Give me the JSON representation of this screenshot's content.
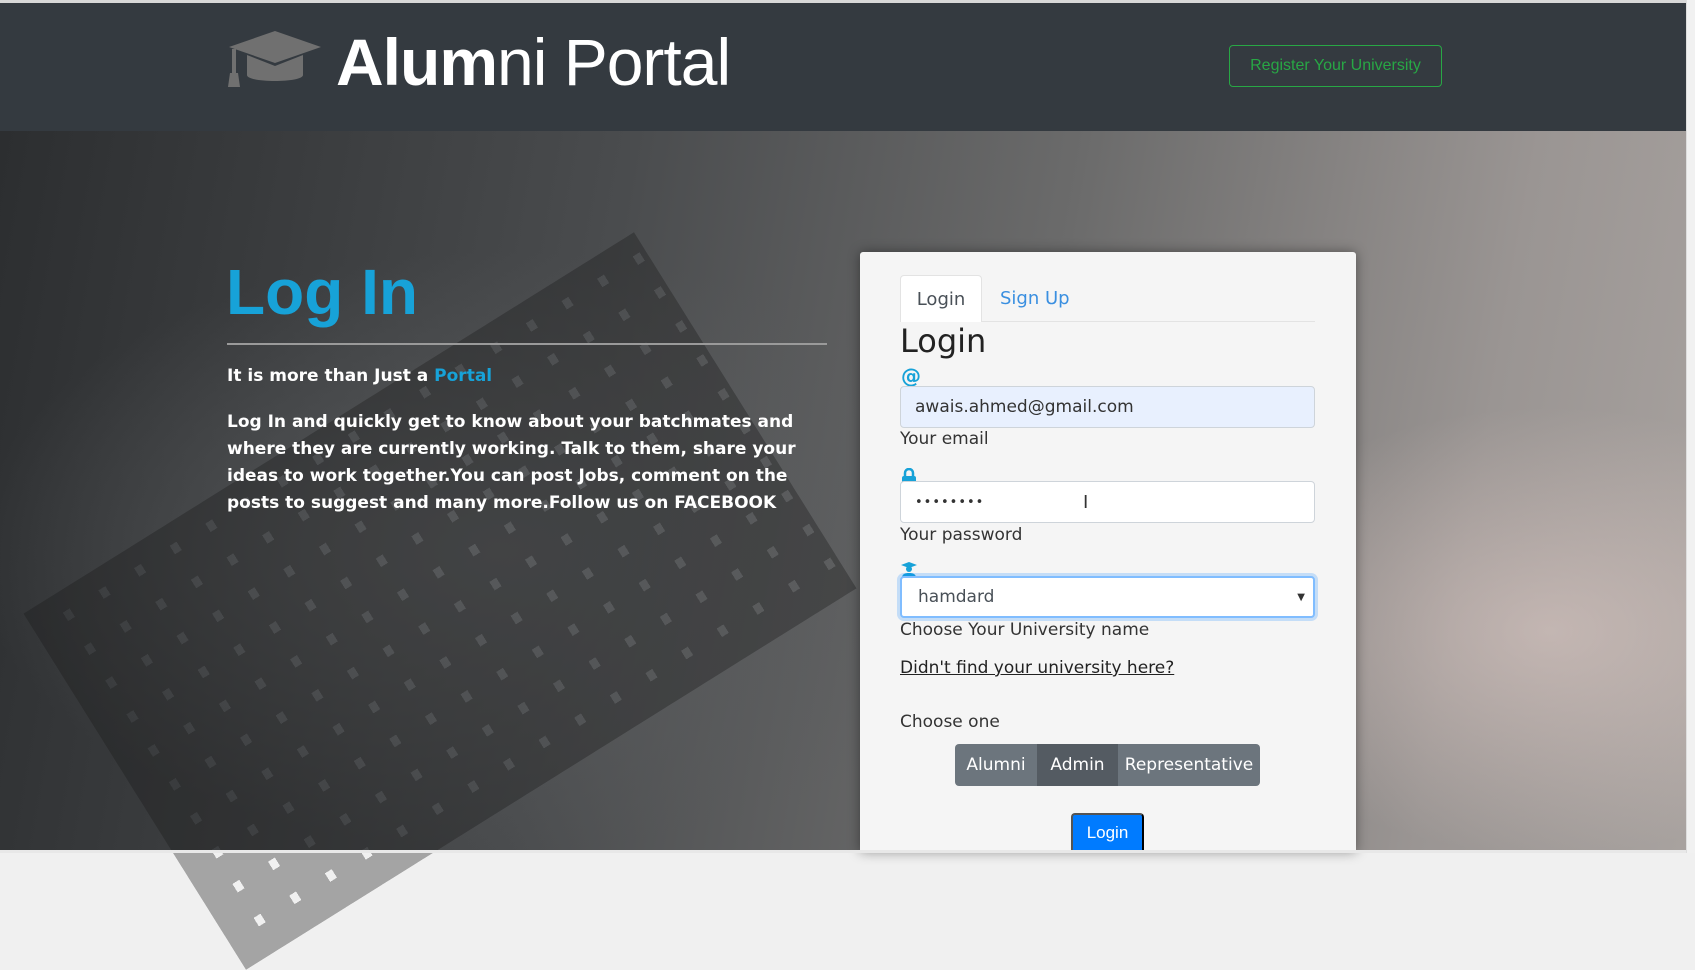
{
  "header": {
    "brand_bold": "Alum",
    "brand_light": "ni Portal",
    "register_label": "Register Your University"
  },
  "hero": {
    "title": "Log In",
    "tagline_prefix": "It is more than Just a ",
    "tagline_highlight": "Portal",
    "description": "Log In and quickly get to know about your batchmates and where they are currently working. Talk to them, share your ideas to work together.You can post Jobs, comment on the posts to suggest and many more.Follow us on FACEBOOK"
  },
  "panel": {
    "tabs": [
      {
        "label": "Login"
      },
      {
        "label": "Sign Up"
      }
    ],
    "title": "Login",
    "email": {
      "icon": "@",
      "value": "awais.ahmed@gmail.com",
      "label": "Your email"
    },
    "password": {
      "value": "••••••••",
      "label": "Your password"
    },
    "university": {
      "value": "hamdard",
      "label": "Choose Your University name"
    },
    "missing_link": "Didn't find your university here?",
    "role_label": "Choose one",
    "roles": [
      {
        "label": "Alumni"
      },
      {
        "label": "Admin"
      },
      {
        "label": "Representative"
      }
    ],
    "selected_role": "Admin",
    "submit": "Login"
  },
  "colors": {
    "header": "#343a40",
    "accent": "#17a2d8",
    "success": "#28a745",
    "primary": "#007bff"
  }
}
